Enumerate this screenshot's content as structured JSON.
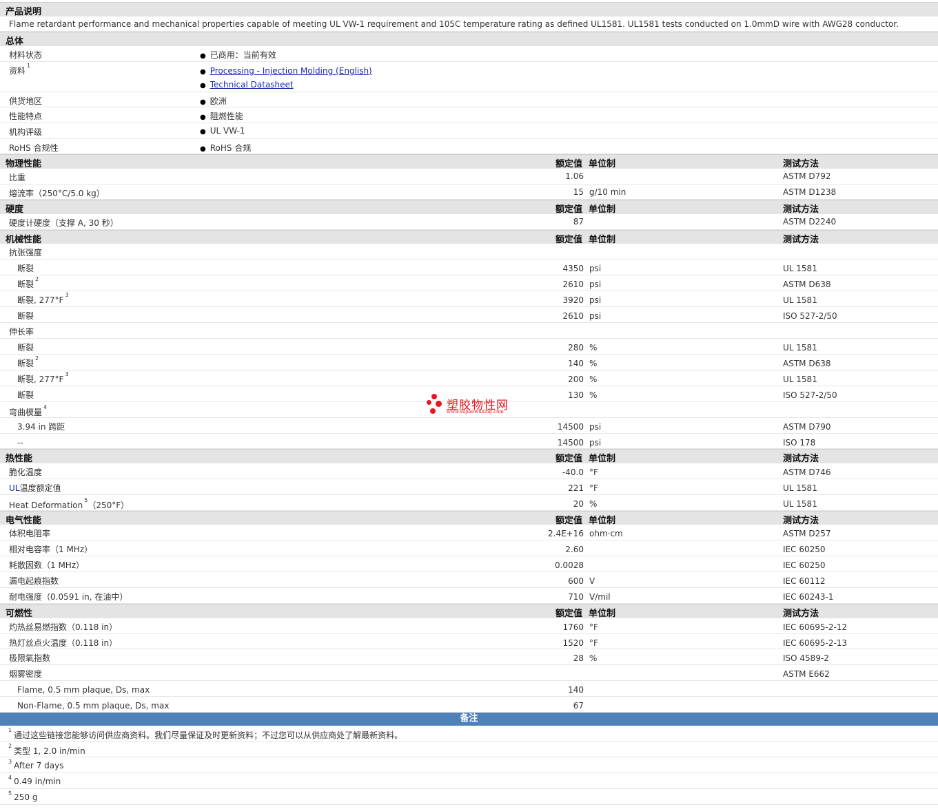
{
  "desc": {
    "title": "产品说明",
    "text": "Flame retardant performance and mechanical properties capable of meeting UL VW-1 requirement and 105C temperature rating as defined UL1581. UL1581 tests conducted on 1.0mmD wire with AWG28 conductor."
  },
  "general": {
    "title": "总体",
    "status_label": "材料状态",
    "status_value": "已商用：当前有效",
    "docs_label": "资料",
    "docs_sup": "1",
    "doc1": "Processing - Injection Molding (English)",
    "doc2": "Technical Datasheet",
    "region_label": "供货地区",
    "region_value": "欧洲",
    "feature_label": "性能特点",
    "feature_value": "阻燃性能",
    "agency_label": "机构评级",
    "agency_value": "UL VW-1",
    "rohs_label": "RoHS 合规性",
    "rohs_value": "RoHS 合规"
  },
  "headers": {
    "nominal": "额定值",
    "unit": "单位制",
    "method": "测试方法"
  },
  "physical": {
    "title": "物理性能",
    "r1": {
      "label": "比重",
      "value": "1.06",
      "unit": "",
      "method": "ASTM D792"
    },
    "r2": {
      "label": "熔流率（250°C/5.0 kg）",
      "value": "15",
      "unit": "g/10 min",
      "method": "ASTM D1238"
    }
  },
  "hardness": {
    "title": "硬度",
    "r1": {
      "label": "硬度计硬度（支撑 A, 30 秒）",
      "value": "87",
      "unit": "",
      "method": "ASTM D2240"
    }
  },
  "mechanical": {
    "title": "机械性能",
    "tensile": "抗张强度",
    "t1": {
      "label": "断裂",
      "sup": "",
      "value": "4350",
      "unit": "psi",
      "method": "UL 1581"
    },
    "t2": {
      "label": "断裂",
      "sup": "2",
      "value": "2610",
      "unit": "psi",
      "method": "ASTM D638"
    },
    "t3": {
      "label": "断裂, 277°F",
      "sup": "3",
      "value": "3920",
      "unit": "psi",
      "method": "UL 1581"
    },
    "t4": {
      "label": "断裂",
      "sup": "",
      "value": "2610",
      "unit": "psi",
      "method": "ISO 527-2/50"
    },
    "elong": "伸长率",
    "e1": {
      "label": "断裂",
      "sup": "",
      "value": "280",
      "unit": "%",
      "method": "UL 1581"
    },
    "e2": {
      "label": "断裂",
      "sup": "2",
      "value": "140",
      "unit": "%",
      "method": "ASTM D638"
    },
    "e3": {
      "label": "断裂, 277°F",
      "sup": "3",
      "value": "200",
      "unit": "%",
      "method": "UL 1581"
    },
    "e4": {
      "label": "断裂",
      "sup": "",
      "value": "130",
      "unit": "%",
      "method": "ISO 527-2/50"
    },
    "flex": "弯曲模量",
    "flex_sup": "4",
    "f1": {
      "label": "3.94 in 跨距",
      "value": "14500",
      "unit": "psi",
      "method": "ASTM D790"
    },
    "f2": {
      "label": "--",
      "value": "14500",
      "unit": "psi",
      "method": "ISO 178"
    }
  },
  "thermal": {
    "title": "热性能",
    "r1": {
      "label": "脆化温度",
      "value": "-40.0",
      "unit": "°F",
      "method": "ASTM D746"
    },
    "r2_prefix": "UL",
    "r2_rest": "温度额定值",
    "r2": {
      "value": "221",
      "unit": "°F",
      "method": "UL 1581"
    },
    "r3": {
      "label": "Heat Deformation",
      "sup": "5",
      "suffix": "（250°F）",
      "value": "20",
      "unit": "%",
      "method": "UL 1581"
    }
  },
  "electrical": {
    "title": "电气性能",
    "r1": {
      "label": "体积电阻率",
      "value": "2.4E+16",
      "unit": "ohm·cm",
      "method": "ASTM D257"
    },
    "r2": {
      "label": "相对电容率（1 MHz）",
      "value": "2.60",
      "unit": "",
      "method": "IEC 60250"
    },
    "r3": {
      "label": "耗散因数（1 MHz）",
      "value": "0.0028",
      "unit": "",
      "method": "IEC 60250"
    },
    "r4": {
      "label": "漏电起痕指数",
      "value": "600",
      "unit": "V",
      "method": "IEC 60112"
    },
    "r5": {
      "label": "耐电强度（0.0591 in, 在油中）",
      "value": "710",
      "unit": "V/mil",
      "method": "IEC 60243-1"
    }
  },
  "flammability": {
    "title": "可燃性",
    "r1": {
      "label": "灼热丝易燃指数（0.118 in）",
      "value": "1760",
      "unit": "°F",
      "method": "IEC 60695-2-12"
    },
    "r2": {
      "label": "热灯丝点火温度（0.118 in）",
      "value": "1520",
      "unit": "°F",
      "method": "IEC 60695-2-13"
    },
    "r3": {
      "label": "极限氧指数",
      "value": "28",
      "unit": "%",
      "method": "ISO 4589-2"
    },
    "r4": {
      "label": "烟雾密度",
      "method": "ASTM E662"
    },
    "r5": {
      "label": "Flame, 0.5 mm plaque, Ds, max",
      "value": "140"
    },
    "r6": {
      "label": "Non-Flame, 0.5 mm plaque, Ds, max",
      "value": "67"
    }
  },
  "notes": {
    "title": "备注",
    "n1": {
      "num": "1",
      "text": "通过这些链接您能够访问供应商资料。我们尽量保证及时更新资料；不过您可以从供应商处了解最新资料。"
    },
    "n2": {
      "num": "2",
      "text": "类型  1, 2.0 in/min"
    },
    "n3": {
      "num": "3",
      "text": "After 7 days"
    },
    "n4": {
      "num": "4",
      "text": "0.49 in/min"
    },
    "n5": {
      "num": "5",
      "text": "250 g"
    }
  },
  "watermark": {
    "text": "塑胶物性网",
    "url": "www.sujiaowuxing.com",
    "color": "#e8141e"
  }
}
